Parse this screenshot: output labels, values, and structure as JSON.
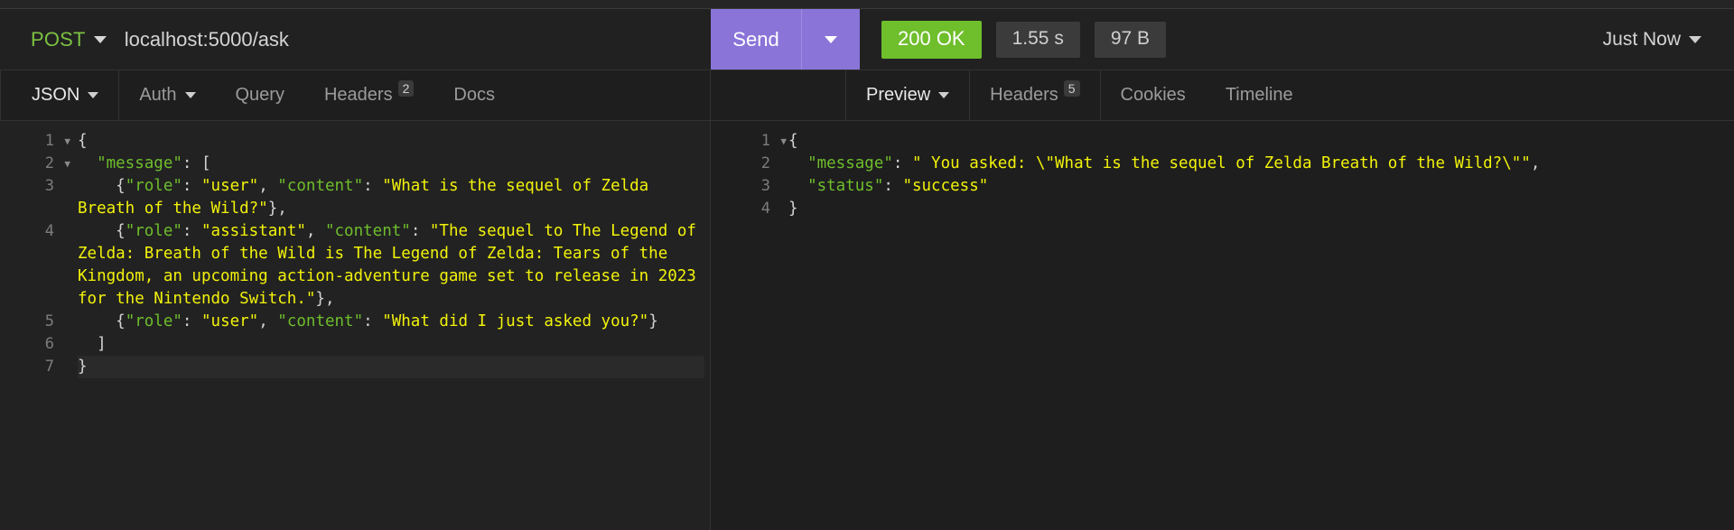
{
  "request": {
    "method": "POST",
    "url": "localhost:5000/ask",
    "send_label": "Send",
    "method_caret": "chevron-down-icon",
    "send_caret": "chevron-down-icon"
  },
  "response_status": {
    "status": "200 OK",
    "time": "1.55 s",
    "size": "97 B",
    "when": "Just Now"
  },
  "request_tabs": [
    {
      "label": "JSON",
      "caret": true,
      "badge": "",
      "active": true
    },
    {
      "label": "Auth",
      "caret": true,
      "badge": "",
      "active": false
    },
    {
      "label": "Query",
      "caret": false,
      "badge": "",
      "active": false
    },
    {
      "label": "Headers",
      "caret": false,
      "badge": "2",
      "active": false
    },
    {
      "label": "Docs",
      "caret": false,
      "badge": "",
      "active": false
    }
  ],
  "response_tabs": [
    {
      "label": "Preview",
      "caret": true,
      "badge": "",
      "active": true
    },
    {
      "label": "Headers",
      "caret": false,
      "badge": "5",
      "active": false
    },
    {
      "label": "Cookies",
      "caret": false,
      "badge": "",
      "active": false
    },
    {
      "label": "Timeline",
      "caret": false,
      "badge": "",
      "active": false
    }
  ],
  "request_body": {
    "line_numbers": [
      "1",
      "2",
      "3",
      "4",
      "5",
      "6",
      "7"
    ],
    "folds": [
      true,
      true,
      false,
      false,
      false,
      false,
      false
    ],
    "current_line": 7,
    "lines": [
      {
        "n": "1",
        "segments": [
          {
            "t": "{",
            "c": "p"
          }
        ]
      },
      {
        "n": "2",
        "segments": [
          {
            "t": "  ",
            "c": "p"
          },
          {
            "t": "\"message\"",
            "c": "k"
          },
          {
            "t": ": [",
            "c": "p"
          }
        ]
      },
      {
        "n": "3",
        "segments": [
          {
            "t": "    {",
            "c": "p"
          },
          {
            "t": "\"role\"",
            "c": "k"
          },
          {
            "t": ": ",
            "c": "p"
          },
          {
            "t": "\"user\"",
            "c": "s"
          },
          {
            "t": ", ",
            "c": "p"
          },
          {
            "t": "\"content\"",
            "c": "k"
          },
          {
            "t": ": ",
            "c": "p"
          },
          {
            "t": "\"What is the sequel of Zelda Breath of the Wild?\"",
            "c": "s"
          },
          {
            "t": "},",
            "c": "p"
          }
        ]
      },
      {
        "n": "4",
        "segments": [
          {
            "t": "    {",
            "c": "p"
          },
          {
            "t": "\"role\"",
            "c": "k"
          },
          {
            "t": ": ",
            "c": "p"
          },
          {
            "t": "\"assistant\"",
            "c": "s"
          },
          {
            "t": ", ",
            "c": "p"
          },
          {
            "t": "\"content\"",
            "c": "k"
          },
          {
            "t": ": ",
            "c": "p"
          },
          {
            "t": "\"The sequel to The Legend of Zelda: Breath of the Wild is The Legend of Zelda: Tears of the Kingdom, an upcoming action-adventure game set to release in 2023 for the Nintendo Switch.\"",
            "c": "s"
          },
          {
            "t": "},",
            "c": "p"
          }
        ]
      },
      {
        "n": "5",
        "segments": [
          {
            "t": "    {",
            "c": "p"
          },
          {
            "t": "\"role\"",
            "c": "k"
          },
          {
            "t": ": ",
            "c": "p"
          },
          {
            "t": "\"user\"",
            "c": "s"
          },
          {
            "t": ", ",
            "c": "p"
          },
          {
            "t": "\"content\"",
            "c": "k"
          },
          {
            "t": ": ",
            "c": "p"
          },
          {
            "t": "\"What did I just asked you?\"",
            "c": "s"
          },
          {
            "t": "}",
            "c": "p"
          }
        ]
      },
      {
        "n": "6",
        "segments": [
          {
            "t": "  ]",
            "c": "p"
          }
        ]
      },
      {
        "n": "7",
        "segments": [
          {
            "t": "}",
            "c": "p"
          }
        ]
      }
    ]
  },
  "response_body": {
    "line_numbers": [
      "1",
      "2",
      "3",
      "4"
    ],
    "folds": [
      true,
      false,
      false,
      false
    ],
    "lines": [
      {
        "n": "1",
        "segments": [
          {
            "t": "{",
            "c": "p"
          }
        ]
      },
      {
        "n": "2",
        "segments": [
          {
            "t": "  ",
            "c": "p"
          },
          {
            "t": "\"message\"",
            "c": "k"
          },
          {
            "t": ": ",
            "c": "p"
          },
          {
            "t": "\" You asked: \\\"What is the sequel of Zelda Breath of the Wild?\\\"\"",
            "c": "s"
          },
          {
            "t": ",",
            "c": "p"
          }
        ]
      },
      {
        "n": "3",
        "segments": [
          {
            "t": "  ",
            "c": "p"
          },
          {
            "t": "\"status\"",
            "c": "k"
          },
          {
            "t": ": ",
            "c": "p"
          },
          {
            "t": "\"success\"",
            "c": "s"
          }
        ]
      },
      {
        "n": "4",
        "segments": [
          {
            "t": "}",
            "c": "p"
          }
        ]
      }
    ]
  },
  "colors": {
    "send_purple": "#8a74d8",
    "status_green": "#6fbe2c",
    "method_green": "#7cc142",
    "json_key": "#6fbe2c",
    "json_string": "#f2f20b",
    "background": "#1e1e1e"
  }
}
